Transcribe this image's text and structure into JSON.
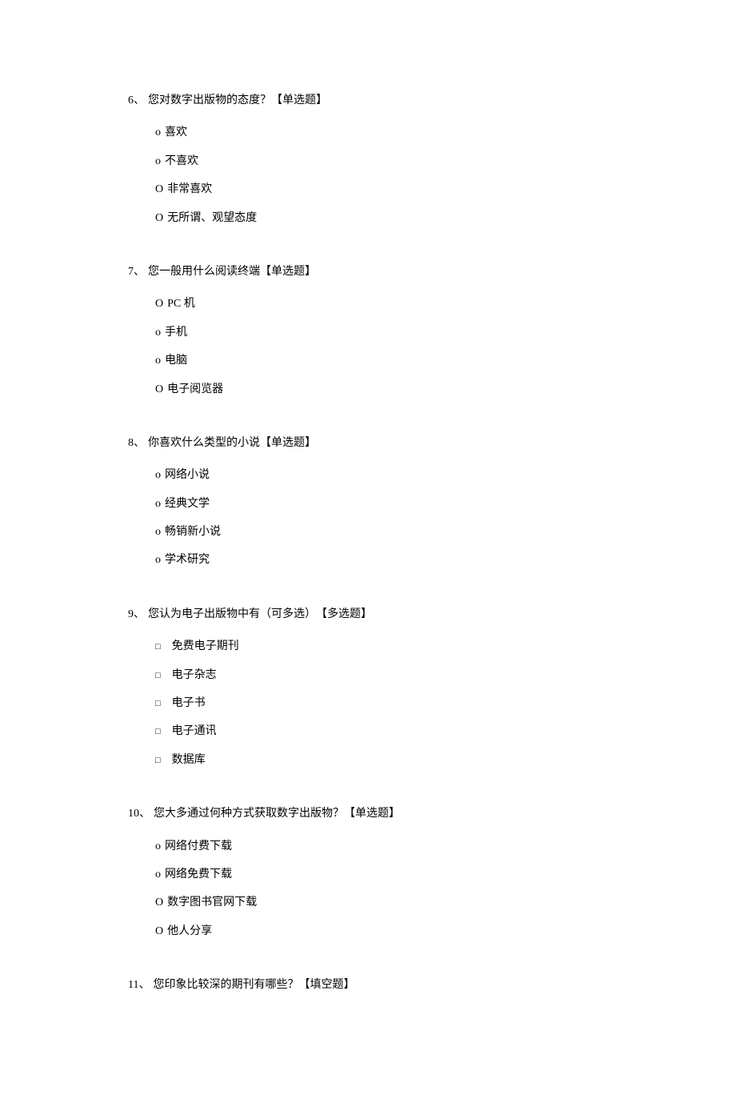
{
  "questions": [
    {
      "number": "6、",
      "text": "您对数字出版物的态度？",
      "tag": "【单选题】",
      "type": "radio",
      "options": [
        {
          "marker": "o",
          "text": "喜欢"
        },
        {
          "marker": "o",
          "text": "不喜欢"
        },
        {
          "marker": "O",
          "text": "非常喜欢"
        },
        {
          "marker": "O",
          "text": "无所谓、观望态度"
        }
      ]
    },
    {
      "number": "7、",
      "text": "您一般用什么阅读终端",
      "tag": "【单选题】",
      "type": "radio",
      "options": [
        {
          "marker": "O",
          "text": "PC 机"
        },
        {
          "marker": "o",
          "text": "手机"
        },
        {
          "marker": "o",
          "text": "电脑"
        },
        {
          "marker": "O",
          "text": "电子阅览器"
        }
      ]
    },
    {
      "number": "8、",
      "text": "你喜欢什么类型的小说",
      "tag": "【单选题】",
      "type": "radio",
      "options": [
        {
          "marker": "o",
          "text": "网络小说"
        },
        {
          "marker": "o",
          "text": "经典文学"
        },
        {
          "marker": "o",
          "text": "畅销新小说"
        },
        {
          "marker": "o",
          "text": "学术研究"
        }
      ]
    },
    {
      "number": "9、",
      "text": "您认为电子出版物中有（可多选）",
      "tag": "【多选题】",
      "type": "checkbox",
      "options": [
        {
          "marker": "□",
          "text": "免费电子期刊"
        },
        {
          "marker": "□",
          "text": "电子杂志"
        },
        {
          "marker": "□",
          "text": "电子书"
        },
        {
          "marker": "□",
          "text": "电子通讯"
        },
        {
          "marker": "□",
          "text": "数据库"
        }
      ]
    },
    {
      "number": "10、",
      "text": "您大多通过何种方式获取数字出版物？",
      "tag": "【单选题】",
      "type": "radio",
      "options": [
        {
          "marker": "o",
          "text": "网络付费下载"
        },
        {
          "marker": "o",
          "text": "网络免费下载"
        },
        {
          "marker": "O",
          "text": "数字图书官网下载"
        },
        {
          "marker": "O",
          "text": "他人分享"
        }
      ]
    },
    {
      "number": "11、",
      "text": "您印象比较深的期刊有哪些？",
      "tag": "【填空题】",
      "type": "fill",
      "options": []
    }
  ]
}
